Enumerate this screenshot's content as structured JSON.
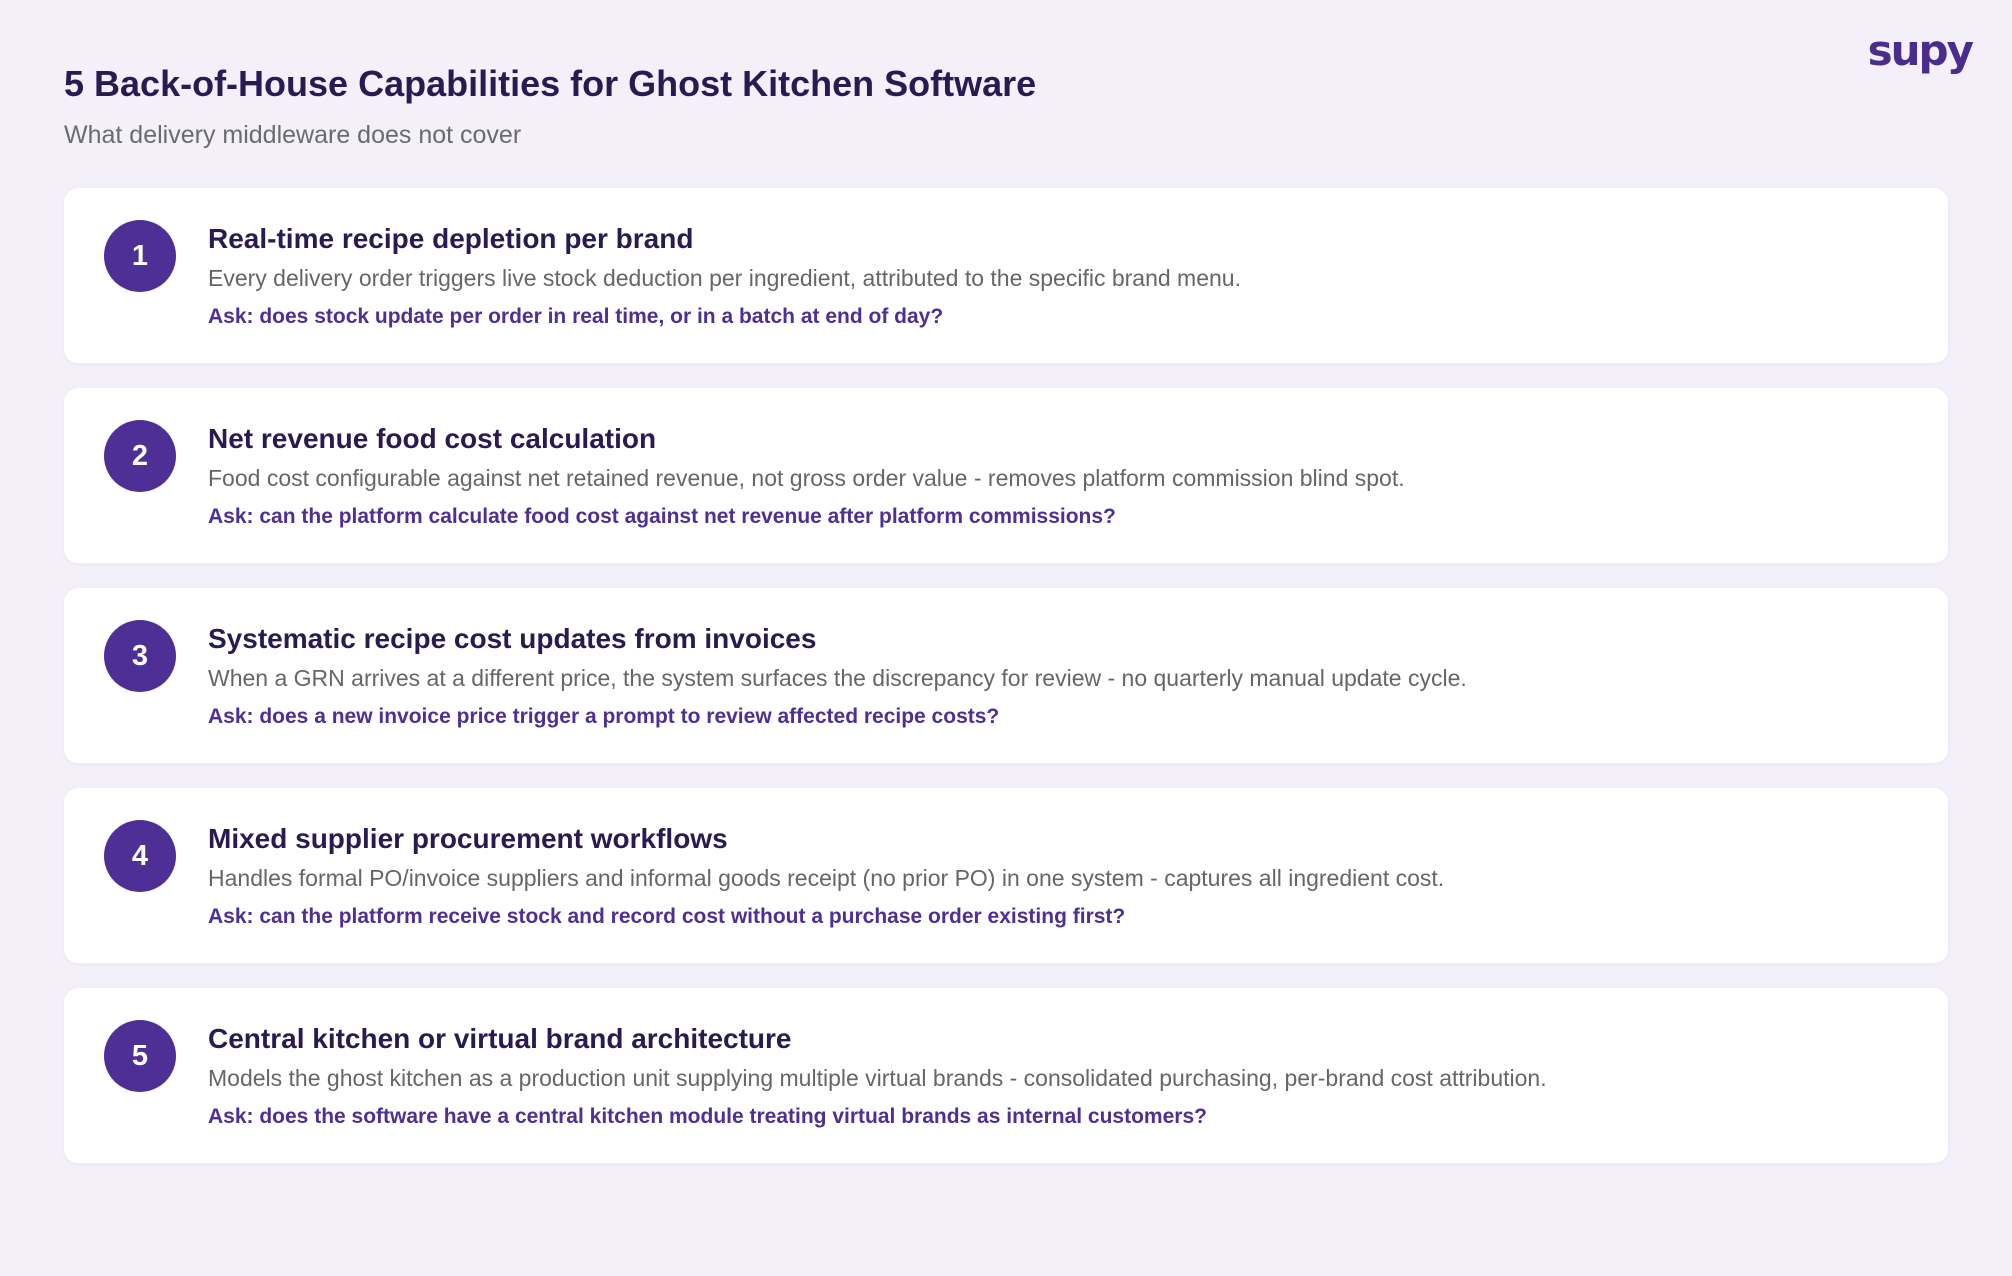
{
  "brand": {
    "logo_text": "supy"
  },
  "header": {
    "title": "5 Back-of-House Capabilities for Ghost Kitchen Software",
    "subtitle": "What delivery middleware does not cover"
  },
  "capabilities": [
    {
      "number": "1",
      "title": "Real-time recipe depletion per brand",
      "description": "Every delivery order triggers live stock deduction per ingredient, attributed to the specific brand menu.",
      "ask": "Ask: does stock update per order in real time, or in a batch at end of day?"
    },
    {
      "number": "2",
      "title": "Net revenue food cost calculation",
      "description": "Food cost configurable against net retained revenue, not gross order value - removes platform commission blind spot.",
      "ask": "Ask: can the platform calculate food cost against net revenue after platform commissions?"
    },
    {
      "number": "3",
      "title": "Systematic recipe cost updates from invoices",
      "description": "When a GRN arrives at a different price, the system surfaces the discrepancy for review - no quarterly manual update cycle.",
      "ask": "Ask: does a new invoice price trigger a prompt to review affected recipe costs?"
    },
    {
      "number": "4",
      "title": "Mixed supplier procurement workflows",
      "description": "Handles formal PO/invoice suppliers and informal goods receipt (no prior PO) in one system - captures all ingredient cost.",
      "ask": "Ask: can the platform receive stock and record cost without a purchase order existing first?"
    },
    {
      "number": "5",
      "title": "Central kitchen or virtual brand architecture",
      "description": "Models the ghost kitchen as a production unit supplying multiple virtual brands - consolidated purchasing, per-brand cost attribution.",
      "ask": "Ask: does the software have a central kitchen module treating virtual brands as internal customers?"
    }
  ],
  "colors": {
    "background": "#f3f0fa",
    "accent": "#4e2f95",
    "title": "#2a1a52",
    "muted": "#666666"
  }
}
